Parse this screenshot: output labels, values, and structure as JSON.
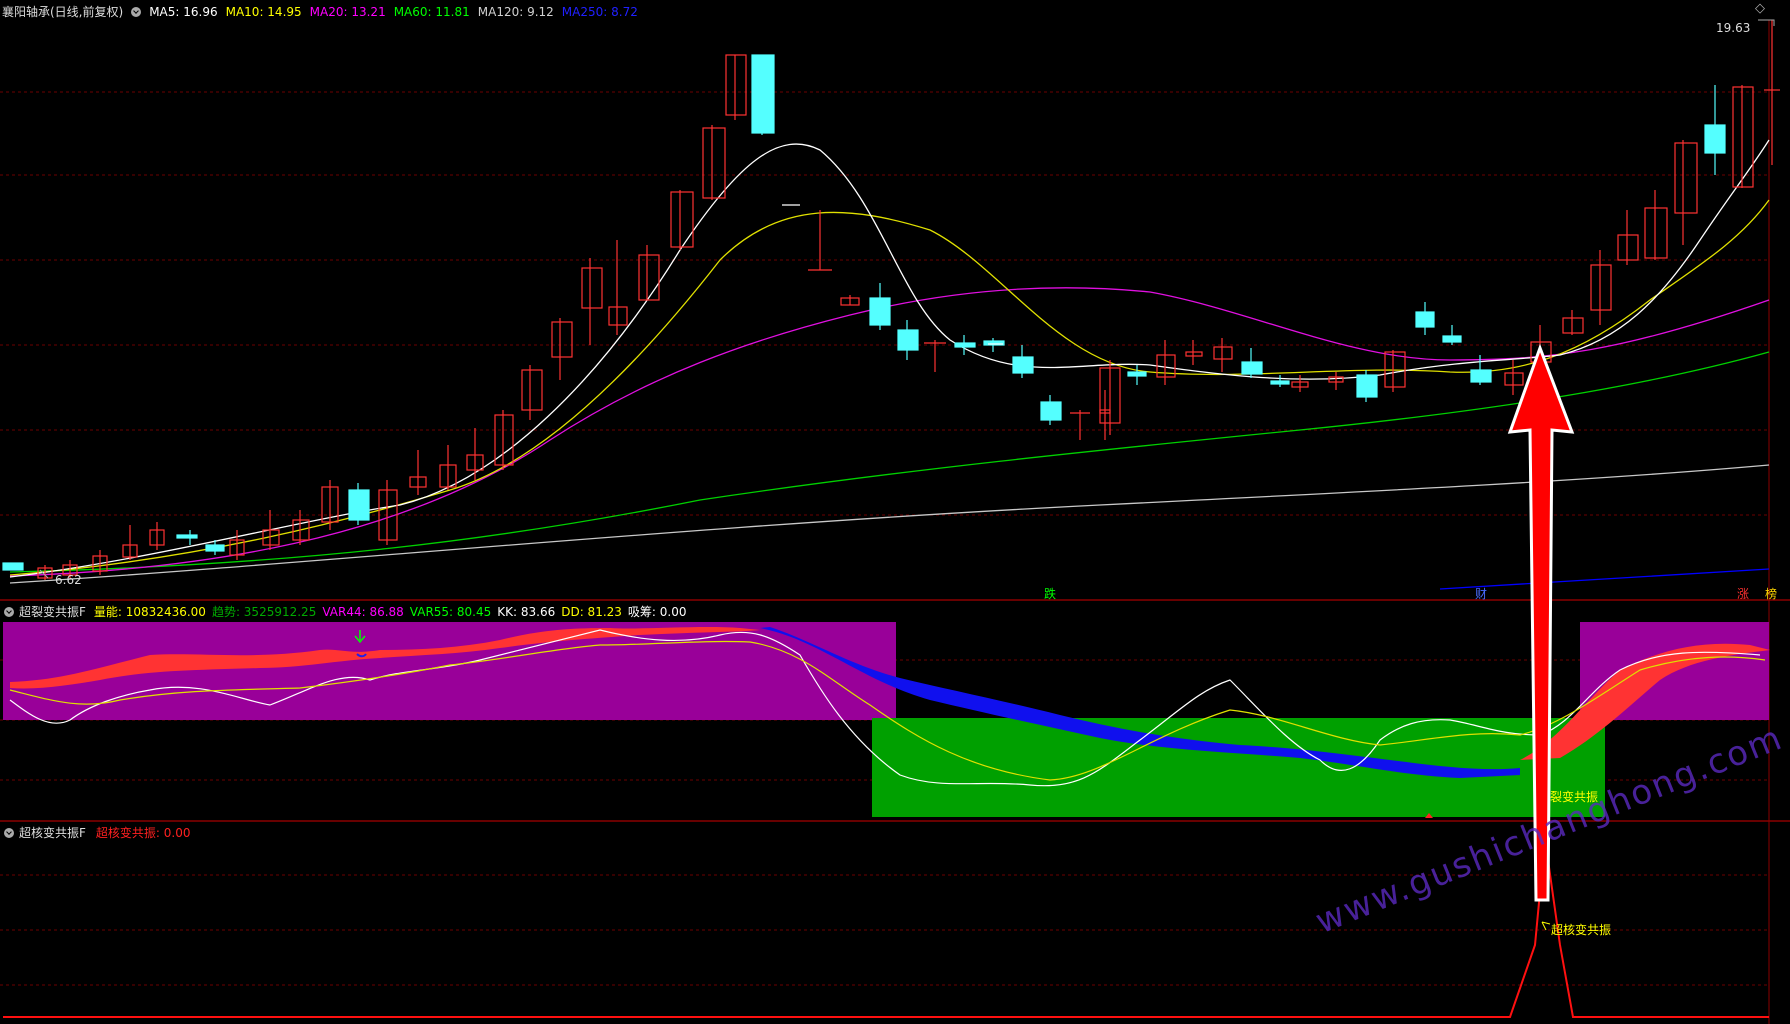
{
  "main": {
    "stock_title": "襄阳轴承(日线,前复权)",
    "ma_labels": [
      {
        "text": "MA5: 16.96",
        "color": "#ffffff"
      },
      {
        "text": "MA10: 14.95",
        "color": "#ffff00"
      },
      {
        "text": "MA20: 13.21",
        "color": "#ff00ff"
      },
      {
        "text": "MA60: 11.81",
        "color": "#00ff00"
      },
      {
        "text": "MA120: 9.12",
        "color": "#d0d0d0"
      },
      {
        "text": "MA250: 8.72",
        "color": "#0000ff"
      }
    ],
    "price_high": "19.63",
    "price_low": "6.62",
    "markers": [
      {
        "text": "跌",
        "color": "#00ff00"
      },
      {
        "text": "财",
        "color": "#4a6cff"
      },
      {
        "text": "涨",
        "color": "#ff3030"
      },
      {
        "text": "榜",
        "color": "#ffd700"
      }
    ]
  },
  "panel2": {
    "title": "超裂变共振F",
    "indicators": [
      {
        "text": "量能: 10832436.00",
        "color": "#ffff00"
      },
      {
        "text": "趋势: 3525912.25",
        "color": "#00aa00"
      },
      {
        "text": "VAR44: 86.88",
        "color": "#ff00ff"
      },
      {
        "text": "VAR55: 80.45",
        "color": "#00ff00"
      },
      {
        "text": "KK: 83.66",
        "color": "#ffffff"
      },
      {
        "text": "DD: 81.23",
        "color": "#ffff00"
      },
      {
        "text": "吸筹: 0.00",
        "color": "#ffffff"
      }
    ],
    "signal_label": "裂变共振"
  },
  "panel3": {
    "title": "超核变共振F",
    "indicator": {
      "text": "超核变共振: 0.00",
      "color": "#ff2020"
    },
    "signal_label": "超核变共振"
  },
  "watermark": "www.gushichanghong.com",
  "colors": {
    "up": "#ff3232",
    "down": "#54ffff",
    "grid": "#8b0000",
    "purple_zone": "#990099",
    "green_zone": "#00a000"
  }
}
